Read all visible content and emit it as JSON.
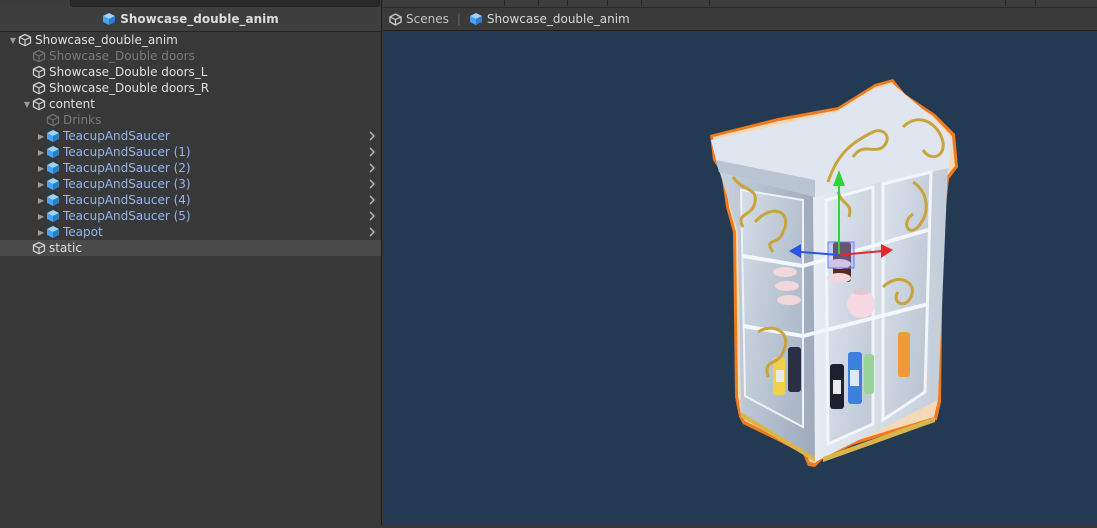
{
  "hierarchy": {
    "title": "Showcase_double_anim",
    "rows": [
      {
        "label": "Showcase_double_anim",
        "style": "white",
        "indent": 0,
        "fold": "open",
        "icon": "cube-outline-icon"
      },
      {
        "label": "Showcase_Double doors",
        "style": "dim",
        "indent": 1,
        "fold": "",
        "icon": "cube-outline-icon"
      },
      {
        "label": "Showcase_Double doors_L",
        "style": "white",
        "indent": 1,
        "fold": "",
        "icon": "cube-outline-icon"
      },
      {
        "label": "Showcase_Double doors_R",
        "style": "white",
        "indent": 1,
        "fold": "",
        "icon": "cube-outline-icon"
      },
      {
        "label": "content",
        "style": "white",
        "indent": 1,
        "fold": "open",
        "icon": "cube-outline-icon"
      },
      {
        "label": "Drinks",
        "style": "dim",
        "indent": 2,
        "fold": "",
        "icon": "cube-outline-icon"
      },
      {
        "label": "TeacupAndSaucer",
        "style": "prefab",
        "indent": 2,
        "fold": "closed",
        "icon": "prefab-cube-icon",
        "chevron": true
      },
      {
        "label": "TeacupAndSaucer (1)",
        "style": "prefab",
        "indent": 2,
        "fold": "closed",
        "icon": "prefab-cube-icon",
        "chevron": true
      },
      {
        "label": "TeacupAndSaucer (2)",
        "style": "prefab",
        "indent": 2,
        "fold": "closed",
        "icon": "prefab-cube-icon",
        "chevron": true
      },
      {
        "label": "TeacupAndSaucer (3)",
        "style": "prefab",
        "indent": 2,
        "fold": "closed",
        "icon": "prefab-cube-icon",
        "chevron": true
      },
      {
        "label": "TeacupAndSaucer (4)",
        "style": "prefab",
        "indent": 2,
        "fold": "closed",
        "icon": "prefab-cube-icon",
        "chevron": true
      },
      {
        "label": "TeacupAndSaucer (5)",
        "style": "prefab",
        "indent": 2,
        "fold": "closed",
        "icon": "prefab-cube-icon",
        "chevron": true
      },
      {
        "label": "Teapot",
        "style": "prefab",
        "indent": 2,
        "fold": "closed",
        "icon": "prefab-cube-icon",
        "chevron": true
      },
      {
        "label": "static",
        "style": "white",
        "indent": 1,
        "fold": "",
        "icon": "cube-outline-icon",
        "selected": true
      }
    ]
  },
  "scene": {
    "breadcrumb_root": "Scenes",
    "breadcrumb_current": "Showcase_double_anim"
  },
  "colors": {
    "panel_bg": "#383838",
    "scene_bg": "#243a53",
    "prefab_text": "#8fb8f0",
    "selection_outline": "#f07a1e",
    "gizmo_x": "#e02a2a",
    "gizmo_y": "#35d13b",
    "gizmo_z": "#2a55e0"
  }
}
